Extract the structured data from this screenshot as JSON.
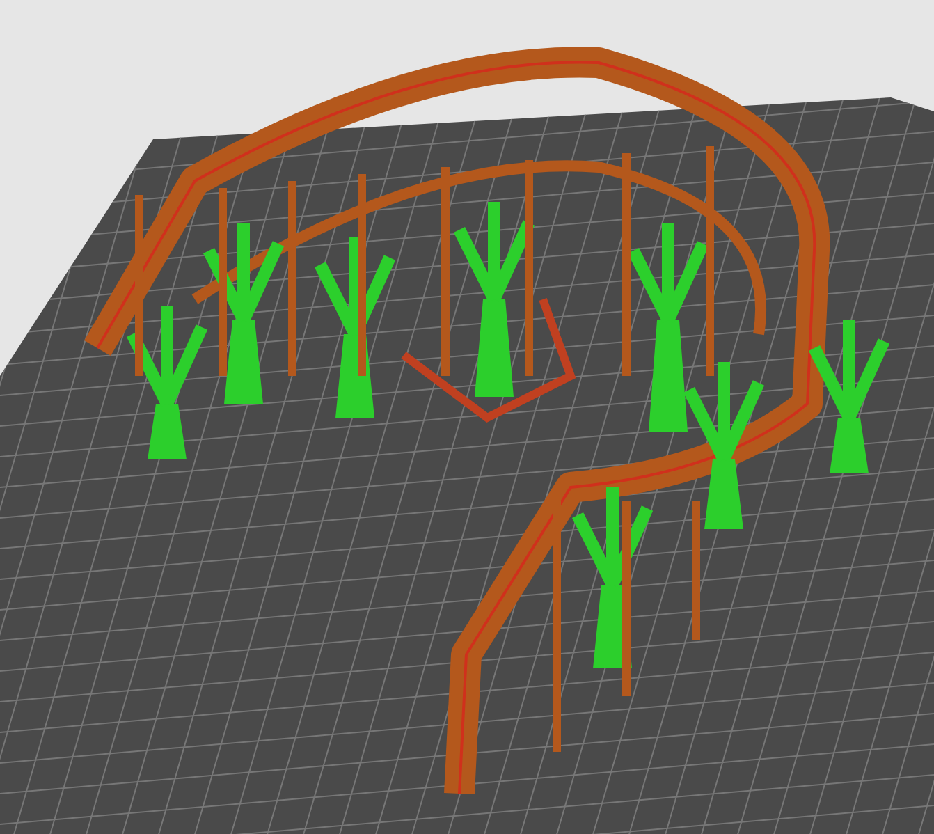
{
  "viewport": {
    "kind": "slicer-preview"
  }
}
